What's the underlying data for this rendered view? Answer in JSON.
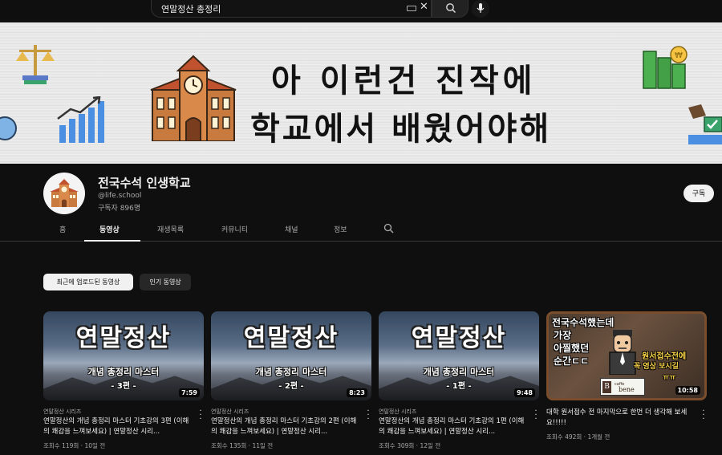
{
  "search": {
    "query": "연말정산 총정리"
  },
  "banner": {
    "line1": "아 이런건 진작에",
    "line2": "학교에서 배웠어야해"
  },
  "channel": {
    "name": "전국수석 인생학교",
    "handle": "@life.school",
    "subscribers": "구독자 896명",
    "subscribe_label": "구독"
  },
  "tabs": [
    {
      "label": "홈"
    },
    {
      "label": "동영상",
      "active": true
    },
    {
      "label": "재생목록"
    },
    {
      "label": "커뮤니티"
    },
    {
      "label": "채널"
    },
    {
      "label": "정보"
    }
  ],
  "chips": [
    {
      "label": "최근에 업로드된 동영상",
      "selected": true
    },
    {
      "label": "인기 동영상",
      "selected": false
    }
  ],
  "videos": [
    {
      "thumb_title": "연말정산",
      "thumb_sub": "개념 총정리 마스터",
      "thumb_part": "- 3편 -",
      "duration": "7:59",
      "series": "연말정산 시리즈",
      "title": "연말정산의 개념 총정리 마스터 기초강의 3편 (이해의 쾌감을 느껴보세요) | 연말정산 시리...",
      "meta": "조회수 119회 · 10일 전"
    },
    {
      "thumb_title": "연말정산",
      "thumb_sub": "개념 총정리 마스터",
      "thumb_part": "- 2편 -",
      "duration": "8:23",
      "series": "연말정산 시리즈",
      "title": "연말정산의 개념 총정리 마스터 기초강의 2편 (이해의 쾌감을 느껴보세요) | 연말정산 시리...",
      "meta": "조회수 135회 · 11일 전"
    },
    {
      "thumb_title": "연말정산",
      "thumb_sub": "개념 총정리 마스터",
      "thumb_part": "- 1편 -",
      "duration": "9:48",
      "series": "연말정산 시리즈",
      "title": "연말정산의 개념 총정리 마스터 기초강의 1편 (이해의 쾌감을 느껴보세요) | 연말정산 시리...",
      "meta": "조회수 309회 · 12일 전"
    },
    {
      "thumb_l1": "전국수석했는데",
      "thumb_l2": "가장",
      "thumb_l3": "아찔했던",
      "thumb_l4": "순간ㄷㄷ",
      "thumb_r1": "원서접수전에",
      "thumb_r2": "꼭 영상 보시길",
      "thumb_r3": "ㅠㅠ",
      "sign_brand_small": "caffe",
      "sign_brand": "bene",
      "sign_letter": "B",
      "duration": "10:58",
      "title": "대학 원서접수 전 마지막으로 한번 더 생각해 보세요!!!!!",
      "meta": "조회수 492회 · 1개월 전"
    }
  ]
}
